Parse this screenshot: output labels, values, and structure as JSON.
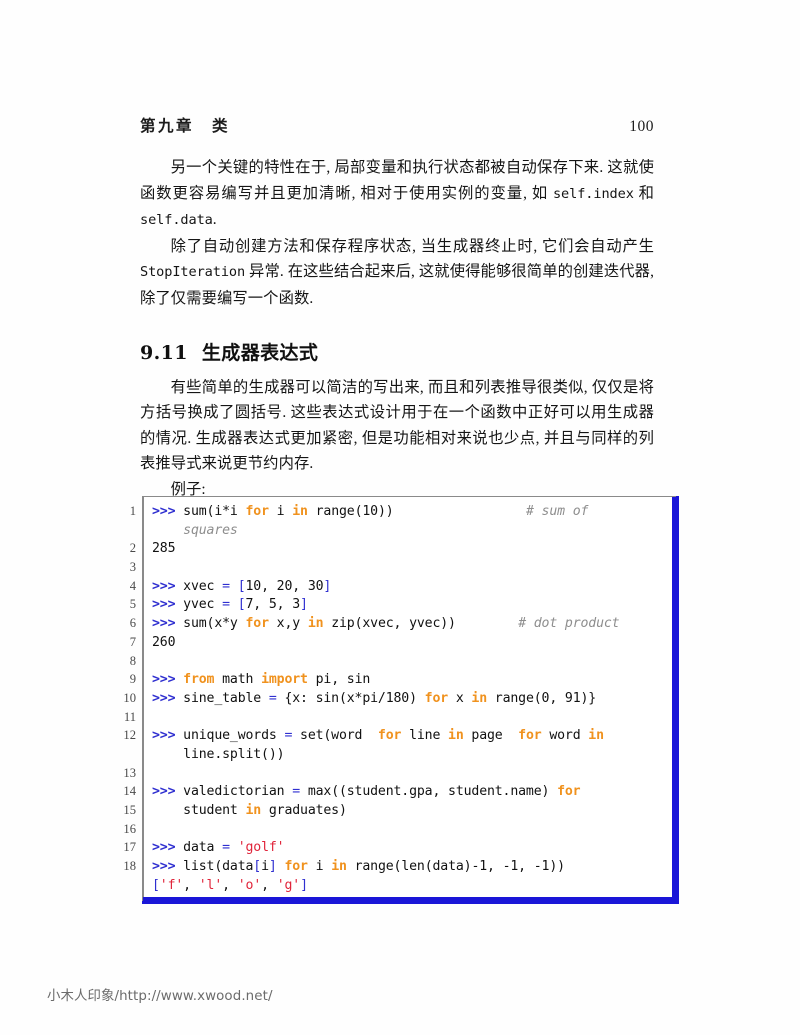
{
  "page": {
    "running_head_chapter": "第九章　类",
    "page_number": "100",
    "watermark": "小木人印象/http://www.xwood.net/"
  },
  "colors": {
    "code_border_shadow": "#1a16d8",
    "code_border": "#8a8a8a",
    "keyword": "#f0921e",
    "prompt": "#2f2fd0",
    "string": "#e0243a",
    "comment": "#8e8e8e",
    "text": "#111111"
  },
  "body": {
    "paragraphs": [
      "另一个关键的特性在于, 局部变量和执行状态都被自动保存下来. 这就使函数更容易编写并且更加清晰, 相对于使用实例的变量, 如 §self.index§ 和 §self.data§.",
      "除了自动创建方法和保存程序状态, 当生成器终止时, 它们会自动产生 §StopIteration§ 异常. 在这些结合起来后, 这就使得能够很简单的创建迭代器, 除了仅需要编写一个函数."
    ],
    "section": {
      "number": "9.11",
      "title": "生成器表达式"
    },
    "paragraphs2": [
      "有些简单的生成器可以简洁的写出来, 而且和列表推导很类似, 仅仅是将方括号换成了圆括号. 这些表达式设计用于在一个函数中正好可以用生成器的情况. 生成器表达式更加紧密, 但是功能相对来说也少点, 并且与同样的列表推导式来说更节约内存."
    ],
    "example_label": "例子:"
  },
  "listing": {
    "line_numbers": [
      "1",
      "2",
      "3",
      "4",
      "5",
      "6",
      "7",
      "8",
      "9",
      "10",
      "11",
      "12",
      "13",
      "14",
      "15",
      "16",
      "17",
      "18"
    ],
    "lines": [
      [
        {
          "t": "prompt",
          "v": ">>> "
        },
        {
          "t": "plain",
          "v": "sum(i*i "
        },
        {
          "t": "kw",
          "v": "for"
        },
        {
          "t": "plain",
          "v": " i "
        },
        {
          "t": "kw",
          "v": "in"
        },
        {
          "t": "plain",
          "v": " range(10))"
        },
        {
          "t": "plain",
          "v": "                 "
        },
        {
          "t": "com",
          "v": "# sum of"
        }
      ],
      [
        {
          "t": "plain",
          "v": "    "
        },
        {
          "t": "com",
          "v": "squares"
        }
      ],
      [
        {
          "t": "plain",
          "v": "285"
        }
      ],
      [
        {
          "t": "plain",
          "v": ""
        }
      ],
      [
        {
          "t": "prompt",
          "v": ">>> "
        },
        {
          "t": "plain",
          "v": "xvec "
        },
        {
          "t": "op",
          "v": "="
        },
        {
          "t": "plain",
          "v": " "
        },
        {
          "t": "op",
          "v": "["
        },
        {
          "t": "plain",
          "v": "10, 20, 30"
        },
        {
          "t": "op",
          "v": "]"
        }
      ],
      [
        {
          "t": "prompt",
          "v": ">>> "
        },
        {
          "t": "plain",
          "v": "yvec "
        },
        {
          "t": "op",
          "v": "="
        },
        {
          "t": "plain",
          "v": " "
        },
        {
          "t": "op",
          "v": "["
        },
        {
          "t": "plain",
          "v": "7, 5, 3"
        },
        {
          "t": "op",
          "v": "]"
        }
      ],
      [
        {
          "t": "prompt",
          "v": ">>> "
        },
        {
          "t": "plain",
          "v": "sum(x*y "
        },
        {
          "t": "kw",
          "v": "for"
        },
        {
          "t": "plain",
          "v": " x,y "
        },
        {
          "t": "kw",
          "v": "in"
        },
        {
          "t": "plain",
          "v": " zip(xvec, yvec))"
        },
        {
          "t": "plain",
          "v": "        "
        },
        {
          "t": "com",
          "v": "# dot product"
        }
      ],
      [
        {
          "t": "plain",
          "v": "260"
        }
      ],
      [
        {
          "t": "plain",
          "v": ""
        }
      ],
      [
        {
          "t": "prompt",
          "v": ">>> "
        },
        {
          "t": "kw",
          "v": "from"
        },
        {
          "t": "plain",
          "v": " math "
        },
        {
          "t": "kw",
          "v": "import"
        },
        {
          "t": "plain",
          "v": " pi, sin"
        }
      ],
      [
        {
          "t": "prompt",
          "v": ">>> "
        },
        {
          "t": "plain",
          "v": "sine_table "
        },
        {
          "t": "op",
          "v": "="
        },
        {
          "t": "plain",
          "v": " {x: sin(x*pi/180) "
        },
        {
          "t": "kw",
          "v": "for"
        },
        {
          "t": "plain",
          "v": " x "
        },
        {
          "t": "kw",
          "v": "in"
        },
        {
          "t": "plain",
          "v": " range(0, 91)}"
        }
      ],
      [
        {
          "t": "plain",
          "v": ""
        }
      ],
      [
        {
          "t": "prompt",
          "v": ">>> "
        },
        {
          "t": "plain",
          "v": "unique_words "
        },
        {
          "t": "op",
          "v": "="
        },
        {
          "t": "plain",
          "v": " set(word  "
        },
        {
          "t": "kw",
          "v": "for"
        },
        {
          "t": "plain",
          "v": " line "
        },
        {
          "t": "kw",
          "v": "in"
        },
        {
          "t": "plain",
          "v": " page  "
        },
        {
          "t": "kw",
          "v": "for"
        },
        {
          "t": "plain",
          "v": " word "
        },
        {
          "t": "kw",
          "v": "in"
        }
      ],
      [
        {
          "t": "plain",
          "v": "    line.split())"
        }
      ],
      [
        {
          "t": "plain",
          "v": ""
        }
      ],
      [
        {
          "t": "prompt",
          "v": ">>> "
        },
        {
          "t": "plain",
          "v": "valedictorian "
        },
        {
          "t": "op",
          "v": "="
        },
        {
          "t": "plain",
          "v": " max((student.gpa, student.name) "
        },
        {
          "t": "kw",
          "v": "for"
        }
      ],
      [
        {
          "t": "plain",
          "v": "    student "
        },
        {
          "t": "kw",
          "v": "in"
        },
        {
          "t": "plain",
          "v": " graduates)"
        }
      ],
      [
        {
          "t": "plain",
          "v": ""
        }
      ],
      [
        {
          "t": "prompt",
          "v": ">>> "
        },
        {
          "t": "plain",
          "v": "data "
        },
        {
          "t": "op",
          "v": "="
        },
        {
          "t": "plain",
          "v": " "
        },
        {
          "t": "str",
          "v": "'golf'"
        }
      ],
      [
        {
          "t": "prompt",
          "v": ">>> "
        },
        {
          "t": "plain",
          "v": "list(data"
        },
        {
          "t": "op",
          "v": "["
        },
        {
          "t": "plain",
          "v": "i"
        },
        {
          "t": "op",
          "v": "]"
        },
        {
          "t": "plain",
          "v": " "
        },
        {
          "t": "kw",
          "v": "for"
        },
        {
          "t": "plain",
          "v": " i "
        },
        {
          "t": "kw",
          "v": "in"
        },
        {
          "t": "plain",
          "v": " range(len(data)-1, -1, -1))"
        }
      ],
      [
        {
          "t": "op",
          "v": "["
        },
        {
          "t": "str",
          "v": "'f'"
        },
        {
          "t": "plain",
          "v": ", "
        },
        {
          "t": "str",
          "v": "'l'"
        },
        {
          "t": "plain",
          "v": ", "
        },
        {
          "t": "str",
          "v": "'o'"
        },
        {
          "t": "plain",
          "v": ", "
        },
        {
          "t": "str",
          "v": "'g'"
        },
        {
          "t": "op",
          "v": "]"
        }
      ]
    ]
  }
}
